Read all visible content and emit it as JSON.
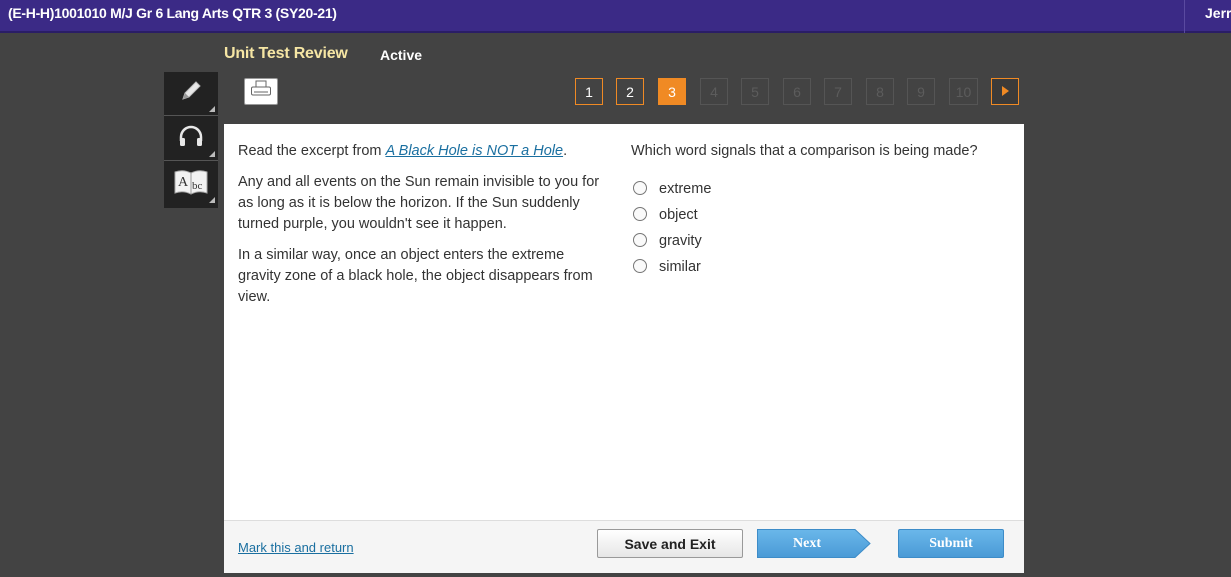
{
  "header": {
    "course_title": "(E-H-H)1001010 M/J Gr 6 Lang Arts QTR 3 (SY20-21)",
    "user_name": "Jerri"
  },
  "test": {
    "title": "Unit Test Review",
    "status": "Active"
  },
  "tools": [
    {
      "icon": "pencil-icon"
    },
    {
      "icon": "headphones-icon"
    },
    {
      "icon": "dictionary-icon",
      "label": "Abc"
    }
  ],
  "print_icon": "print-icon",
  "question_nav": {
    "items": [
      "1",
      "2",
      "3",
      "4",
      "5",
      "6",
      "7",
      "8",
      "9",
      "10"
    ],
    "current": 3,
    "visited": [
      1,
      2
    ],
    "accent_color": "#f08a24"
  },
  "passage": {
    "intro_prefix": "Read the excerpt from ",
    "source_title": "A Black Hole is NOT a Hole",
    "intro_suffix": ".",
    "paragraphs": [
      "Any and all events on the Sun remain invisible to you for as long as it is below the horizon. If the Sun suddenly turned purple, you wouldn't see it happen.",
      "In a similar way, once an object enters the extreme gravity zone of a black hole, the object disappears from view."
    ]
  },
  "question": {
    "prompt": "Which word signals that a comparison is being made?",
    "choices": [
      "extreme",
      "object",
      "gravity",
      "similar"
    ]
  },
  "footer": {
    "mark_link": "Mark this and return",
    "save_exit": "Save and Exit",
    "next": "Next",
    "submit": "Submit"
  },
  "colors": {
    "topbar": "#3b2a86",
    "title": "#f6e6a4",
    "button_blue": "#4a9ad6"
  }
}
